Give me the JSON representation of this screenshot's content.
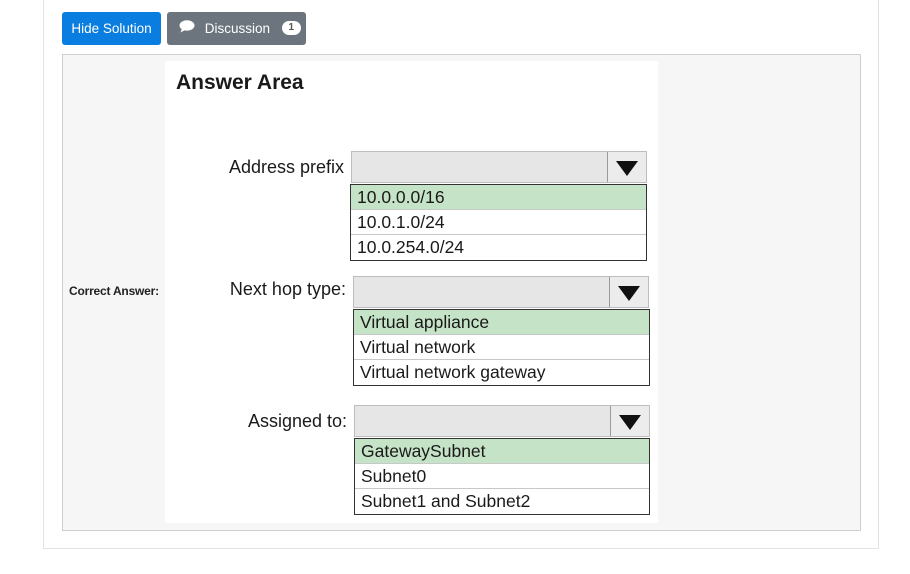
{
  "toolbar": {
    "hide_solution_label": "Hide Solution",
    "discussion_label": "Discussion",
    "discussion_count": "1"
  },
  "answer": {
    "correct_answer_label": "Correct Answer:",
    "area_title": "Answer Area",
    "fields": [
      {
        "label": "Address prefix",
        "options": [
          "10.0.0.0/16",
          "10.0.1.0/24",
          "10.0.254.0/24"
        ],
        "selected": "10.0.0.0/16"
      },
      {
        "label": "Next hop type:",
        "options": [
          "Virtual appliance",
          "Virtual network",
          "Virtual network gateway"
        ],
        "selected": "Virtual appliance"
      },
      {
        "label": "Assigned to:",
        "options": [
          "GatewaySubnet",
          "Subnet0",
          "Subnet1 and Subnet2"
        ],
        "selected": "GatewaySubnet"
      }
    ]
  },
  "colors": {
    "primary_button": "#0a7ee0",
    "secondary_button": "#6c757d",
    "selected_option": "#c5e3c6"
  }
}
